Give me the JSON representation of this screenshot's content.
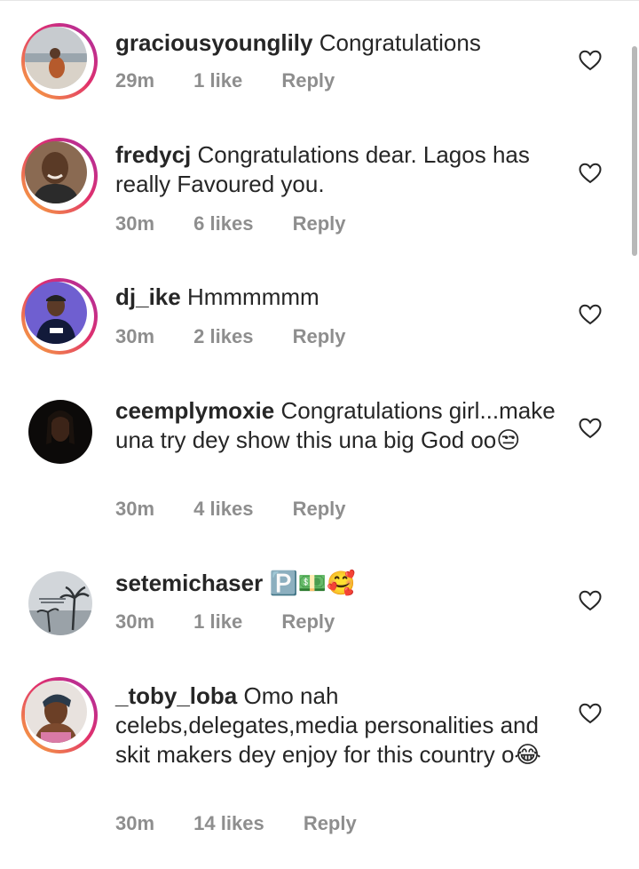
{
  "comments": [
    {
      "username": "graciousyounglily",
      "text": "Congratulations",
      "time": "29m",
      "likes": "1 like",
      "reply": "Reply",
      "avatar": "avatar-beach-portrait-icon"
    },
    {
      "username": "fredycj",
      "text": "Congratulations dear. Lagos has really Favoured you.",
      "time": "30m",
      "likes": "6 likes",
      "reply": "Reply",
      "avatar": "avatar-selfie-man-icon"
    },
    {
      "username": "dj_ike",
      "text": "Hmmmmmm",
      "time": "30m",
      "likes": "2 likes",
      "reply": "Reply",
      "avatar": "avatar-man-cap-icon"
    },
    {
      "username": "ceemplymoxie",
      "text": "Congratulations girl...make una try dey show this una big God oo😒",
      "time": "30m",
      "likes": "4 likes",
      "reply": "Reply",
      "avatar": "avatar-dark-portrait-icon"
    },
    {
      "username": "setemichaser",
      "text": "🅿️💵🥰",
      "time": "30m",
      "likes": "1 like",
      "reply": "Reply",
      "avatar": "avatar-palm-trees-icon"
    },
    {
      "username": "_toby_loba",
      "text": "Omo nah celebs,delegates,media personalities and skit makers dey enjoy for this country o😂",
      "time": "30m",
      "likes": "14 likes",
      "reply": "Reply",
      "avatar": "avatar-woman-headwrap-icon"
    }
  ],
  "colors": {
    "text": "#262626",
    "meta": "#8e8e8e",
    "story_ring_start": "#f9b23a",
    "story_ring_end": "#a62ca6"
  },
  "icons": {
    "like": "heart-outline-icon"
  }
}
